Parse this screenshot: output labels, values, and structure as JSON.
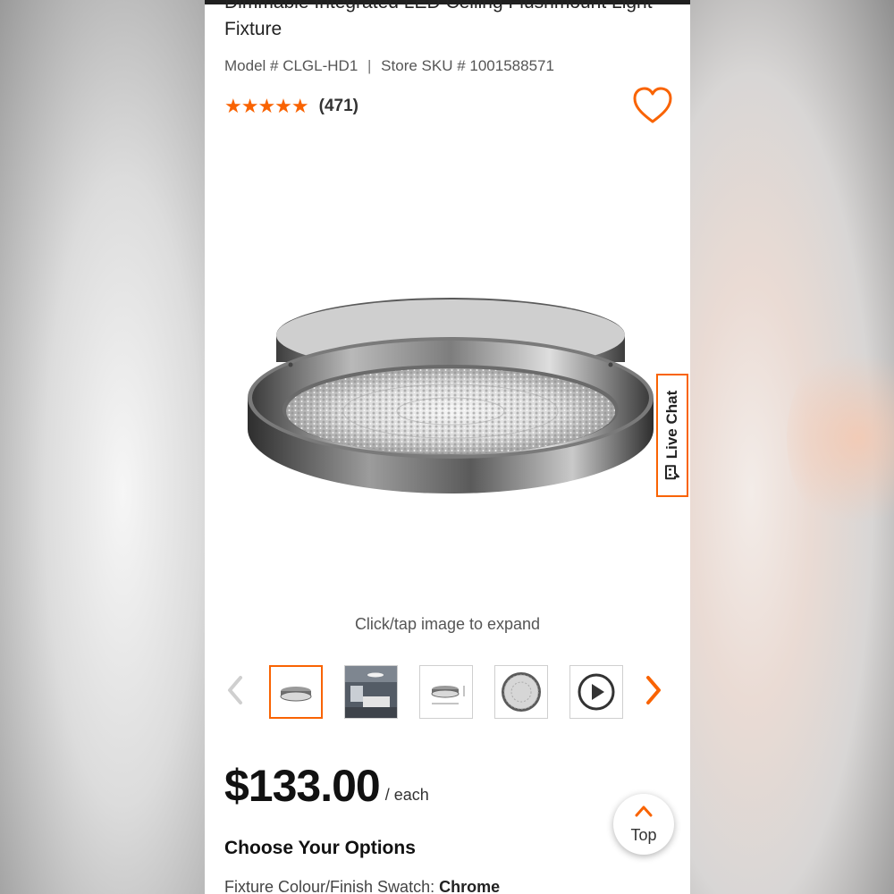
{
  "product": {
    "title": "Dimmable Integrated LED Ceiling Flushmount Light Fixture",
    "model_label": "Model # CLGL-HD1",
    "separator": "|",
    "sku_label": "Store SKU # 1001588571",
    "stars_glyphs": "★★★★★",
    "rating_value": 4.5,
    "rating_max": 5,
    "rating_count": "(471)"
  },
  "icons": {
    "favorite": "heart-outline-icon",
    "live_chat": "chat-bubble-icon",
    "prev": "chevron-left-icon",
    "next": "chevron-right-icon",
    "top": "chevron-up-icon"
  },
  "live_chat": {
    "label": "Live Chat"
  },
  "gallery": {
    "hint": "Click/tap image to expand",
    "prev_glyph": "‹",
    "next_glyph": "›",
    "thumbnails": [
      {
        "kind": "fixture-side",
        "selected": true
      },
      {
        "kind": "room-scene",
        "selected": false
      },
      {
        "kind": "dimensions",
        "selected": false
      },
      {
        "kind": "fixture-top",
        "selected": false
      },
      {
        "kind": "video",
        "selected": false
      }
    ]
  },
  "pricing": {
    "price": "$133.00",
    "unit": "/ each"
  },
  "options": {
    "heading": "Choose Your Options",
    "swatch_label": "Fixture Colour/Finish Swatch:",
    "swatch_value": "Chrome"
  },
  "scroll_top": {
    "label": "Top"
  },
  "colors": {
    "accent": "#f96302",
    "text_primary": "#111111",
    "text_secondary": "#555555"
  }
}
